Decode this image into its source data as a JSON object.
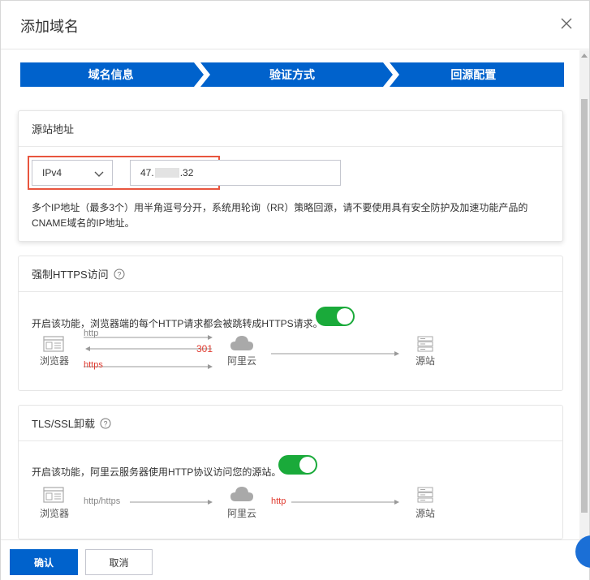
{
  "dialog": {
    "title": "添加域名"
  },
  "steps": [
    "域名信息",
    "验证方式",
    "回源配置"
  ],
  "origin": {
    "title": "源站地址",
    "type_selected": "IPv4",
    "ip_prefix": "47.",
    "ip_suffix": ".32",
    "hint_line1": "多个IP地址（最多3个）用半角逗号分开，系统用轮询（RR）策略回源，请不要使用具有安全防护及加速功能产品的",
    "hint_line2": "CNAME域名的IP地址。"
  },
  "https": {
    "title": "强制HTTPS访问",
    "desc": "开启该功能，浏览器端的每个HTTP请求都会被跳转成HTTPS请求。",
    "enabled": true,
    "diagram": {
      "browser": "浏览器",
      "cdn": "阿里云",
      "origin": "源站",
      "http": "http",
      "redirect": "301",
      "https": "https"
    }
  },
  "tls": {
    "title": "TLS/SSL卸载",
    "desc": "开启该功能，阿里云服务器使用HTTP协议访问您的源站。",
    "enabled": true,
    "diagram": {
      "browser": "浏览器",
      "cdn": "阿里云",
      "origin": "源站",
      "client_proto": "http/https",
      "origin_proto": "http"
    }
  },
  "footer": {
    "confirm": "确认",
    "cancel": "取消"
  },
  "colors": {
    "primary": "#0062cc",
    "toggle_on": "#1aaa3a",
    "highlight": "#e8553e",
    "accent_red": "#e03c31"
  }
}
